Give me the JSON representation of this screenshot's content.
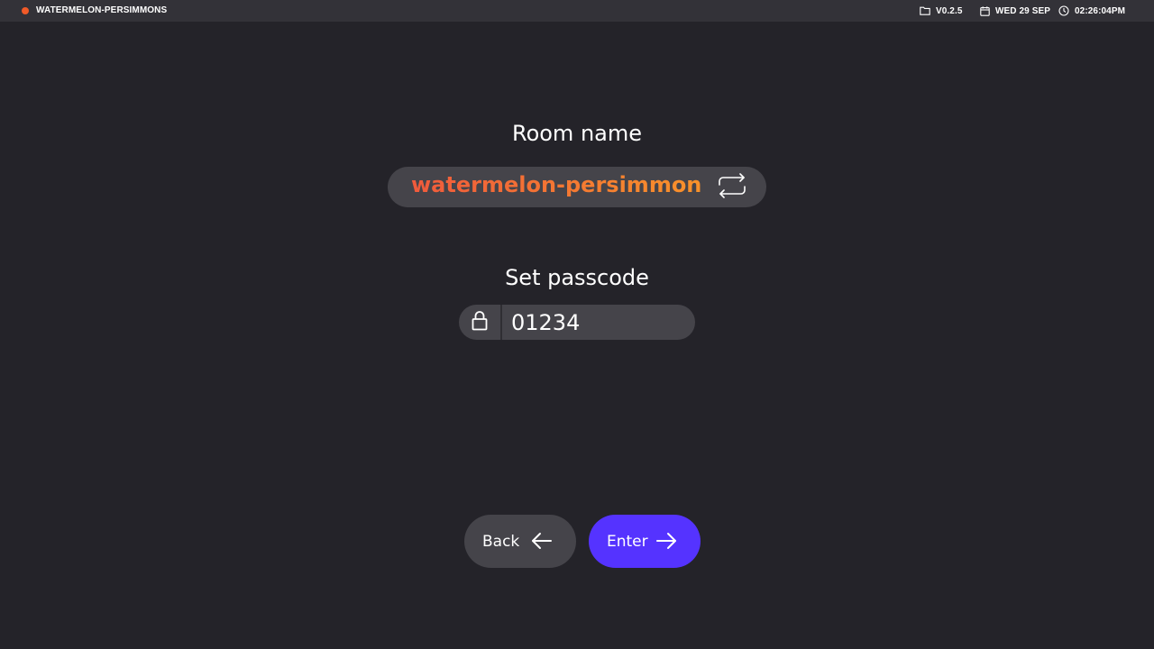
{
  "topbar": {
    "app_title": "WATERMELON-PERSIMMONS",
    "status_color": "#f05a28",
    "version": "V0.2.5",
    "version_icon": "folder-icon",
    "date": "WED 29 SEP",
    "date_icon": "calendar-icon",
    "time": "02:26:04PM",
    "time_icon": "clock-icon"
  },
  "room": {
    "heading": "Room name",
    "name": "watermelon-persimmon",
    "refresh_icon": "refresh-icon"
  },
  "passcode": {
    "heading": "Set passcode",
    "value": "01234",
    "lock_icon": "lock-icon"
  },
  "actions": {
    "back_label": "Back",
    "back_icon": "arrow-left-icon",
    "enter_label": "Enter",
    "enter_icon": "arrow-right-icon"
  },
  "colors": {
    "background": "#242329",
    "topbar": "#333238",
    "pill": "#45444a",
    "accent": "#5533ff",
    "room_name_gradient_start": "#f05a3c",
    "room_name_gradient_end": "#f8922a"
  }
}
